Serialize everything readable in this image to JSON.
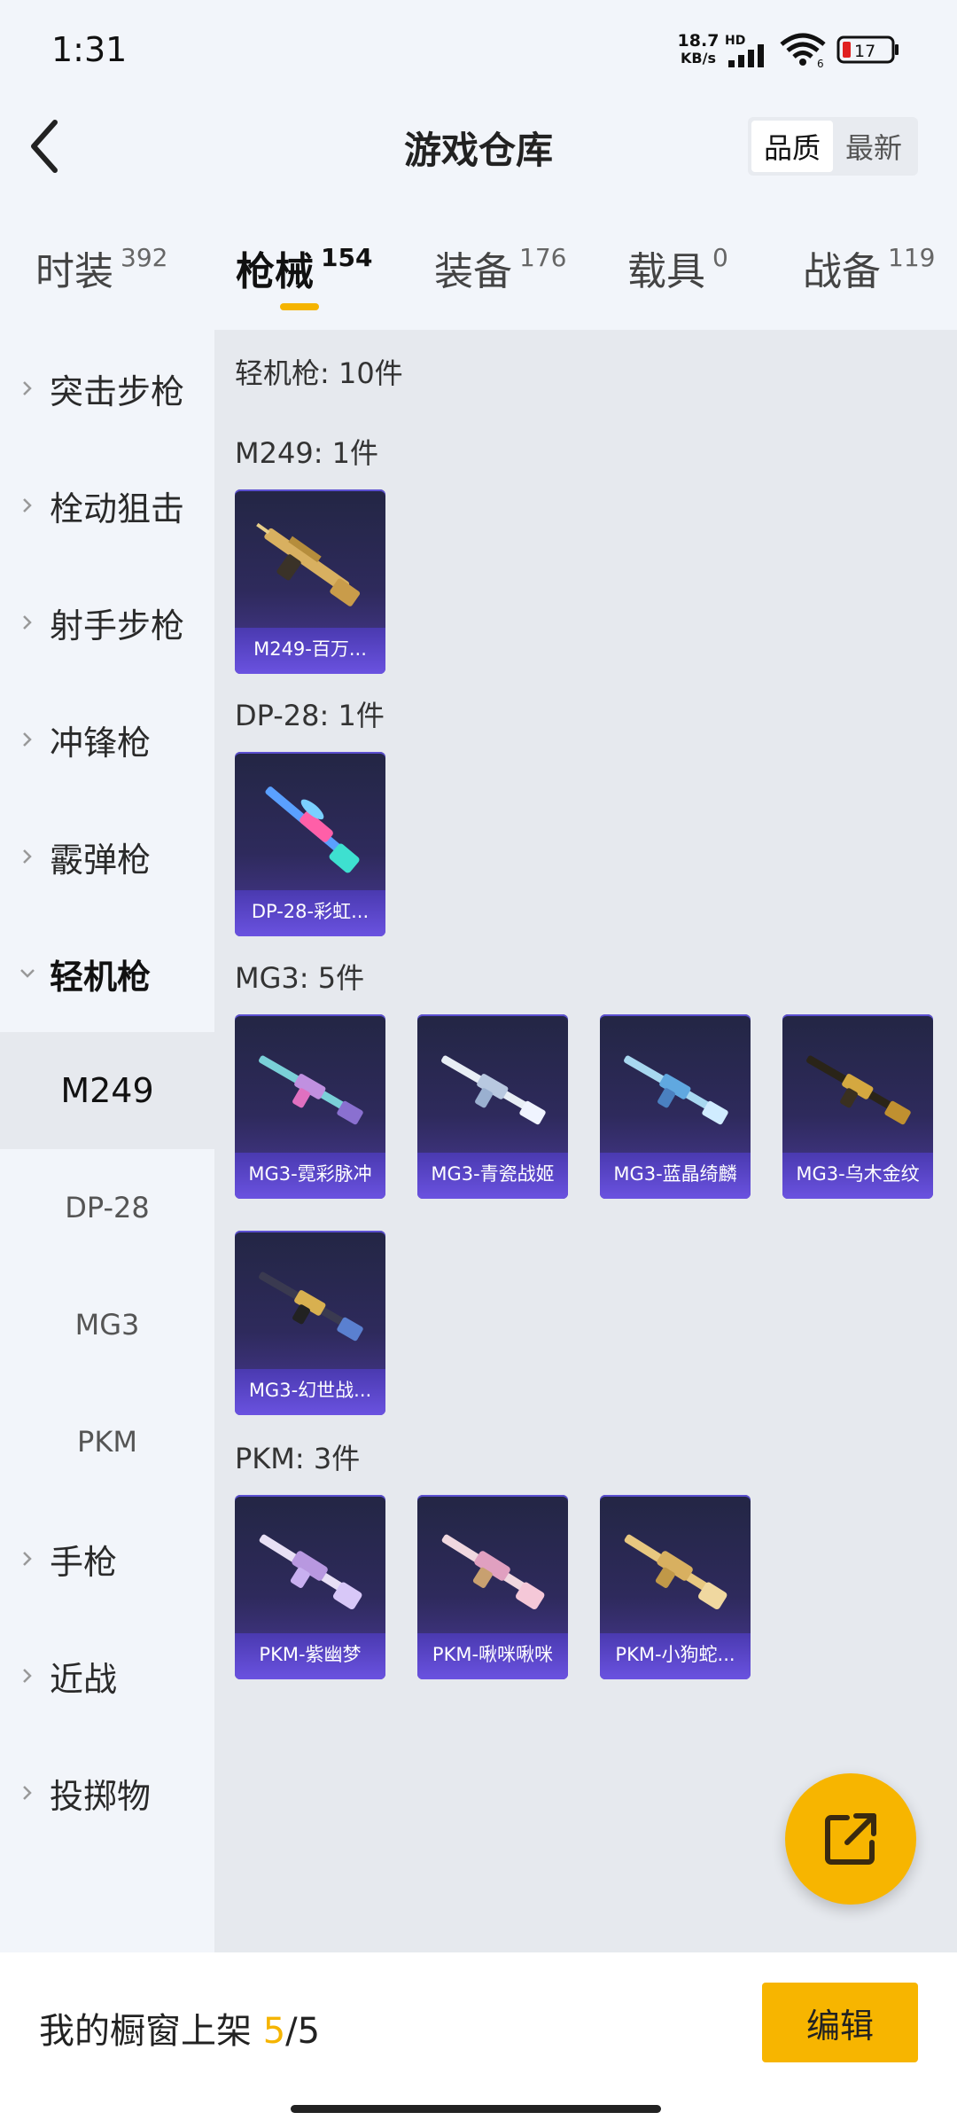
{
  "status_bar": {
    "time": "1:31",
    "net_speed_value": "18.7",
    "net_speed_unit": "KB/s",
    "hd": "HD",
    "wifi_badge": "6",
    "battery": "17"
  },
  "header": {
    "title": "游戏仓库",
    "sort_options": [
      "品质",
      "最新"
    ]
  },
  "tabs": [
    {
      "label": "时装",
      "count": "392"
    },
    {
      "label": "枪械",
      "count": "154"
    },
    {
      "label": "装备",
      "count": "176"
    },
    {
      "label": "载具",
      "count": "0"
    },
    {
      "label": "战备",
      "count": "119"
    }
  ],
  "sidebar": {
    "categories": [
      "突击步枪",
      "栓动狙击",
      "射手步枪",
      "冲锋枪",
      "霰弹枪",
      "轻机枪",
      "手枪",
      "近战",
      "投掷物"
    ],
    "subitems": [
      "M249",
      "DP-28",
      "MG3",
      "PKM"
    ]
  },
  "content": {
    "title": "轻机枪: 10件",
    "groups": [
      {
        "title": "M249: 1件",
        "items": [
          "M249-百万..."
        ]
      },
      {
        "title": "DP-28: 1件",
        "items": [
          "DP-28-彩虹..."
        ]
      },
      {
        "title": "MG3: 5件",
        "items": [
          "MG3-霓彩脉冲",
          "MG3-青瓷战姬",
          "MG3-蓝晶绮麟",
          "MG3-乌木金纹",
          "MG3-幻世战..."
        ]
      },
      {
        "title": "PKM: 3件",
        "items": [
          "PKM-紫幽梦",
          "PKM-啾咪啾咪",
          "PKM-小狗蛇..."
        ]
      }
    ]
  },
  "bottom_bar": {
    "shelf_label": "我的橱窗上架",
    "shelf_count": "5",
    "shelf_total": "/5",
    "edit_label": "编辑"
  },
  "colors": {
    "accent": "#f7b500",
    "card_label_bg": "#6a52e0"
  }
}
